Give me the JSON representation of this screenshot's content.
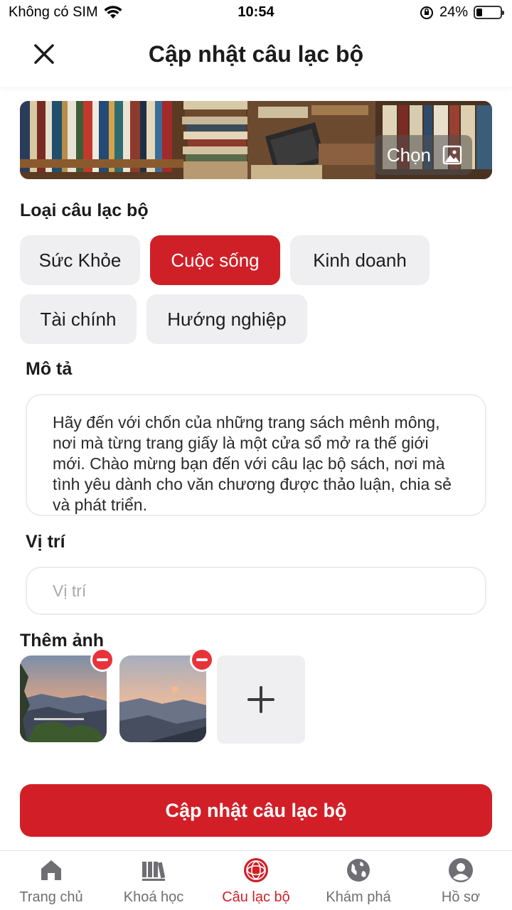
{
  "status_bar": {
    "carrier": "Không có SIM",
    "time": "10:54",
    "battery": "24%",
    "battery_level": 0.24
  },
  "header": {
    "title": "Cập nhật câu lạc bộ",
    "close_icon": "close-icon"
  },
  "cover": {
    "choose_label": "Chọn",
    "choose_icon": "image-icon"
  },
  "club_type": {
    "label": "Loại câu lạc bộ",
    "options": [
      "Sức Khỏe",
      "Cuộc sống",
      "Kinh doanh",
      "Tài chính",
      "Hướng nghiệp"
    ],
    "selected": "Cuộc sống"
  },
  "description": {
    "label": "Mô tả",
    "value": "Hãy đến với chốn của những trang sách mênh mông, nơi mà từng trang giấy là một cửa sổ mở ra thế giới mới. Chào mừng bạn đến với câu lạc bộ sách, nơi mà tình yêu dành cho văn chương được thảo luận, chia sẻ và phát triển."
  },
  "location": {
    "label": "Vị trí",
    "placeholder": "Vị trí",
    "value": ""
  },
  "photos": {
    "label": "Thêm ảnh",
    "count": 2,
    "add_icon": "plus-icon",
    "remove_icon": "minus-icon"
  },
  "submit": {
    "label": "Cập nhật câu lạc bộ"
  },
  "tabbar": {
    "items": [
      {
        "label": "Trang chủ",
        "icon": "home-icon"
      },
      {
        "label": "Khoá học",
        "icon": "books-icon"
      },
      {
        "label": "Câu lạc bộ",
        "icon": "club-icon"
      },
      {
        "label": "Khám phá",
        "icon": "globe-icon"
      },
      {
        "label": "Hồ sơ",
        "icon": "profile-icon"
      }
    ],
    "active_index": 2
  },
  "colors": {
    "accent": "#cf2027",
    "chip_bg": "#efeff1",
    "text": "#1c1c1e"
  }
}
